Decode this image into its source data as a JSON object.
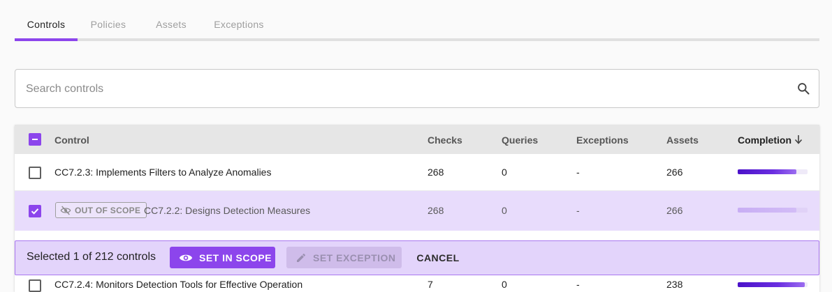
{
  "tabs": [
    {
      "label": "Controls",
      "active": true
    },
    {
      "label": "Policies",
      "active": false
    },
    {
      "label": "Assets",
      "active": false
    },
    {
      "label": "Exceptions",
      "active": false
    }
  ],
  "search": {
    "placeholder": "Search controls",
    "value": "",
    "icon": "search-icon"
  },
  "table": {
    "headers": {
      "control": "Control",
      "checks": "Checks",
      "queries": "Queries",
      "exceptions": "Exceptions",
      "assets": "Assets",
      "completion": "Completion"
    },
    "sort": {
      "column": "completion",
      "direction": "descending",
      "icon": "arrow-down-icon"
    },
    "select_all_state": "indeterminate",
    "rows": [
      {
        "checked": false,
        "out_of_scope": false,
        "control": "CC7.2.3: Implements Filters to Analyze Anomalies",
        "checks": "268",
        "queries": "0",
        "exceptions": "-",
        "assets": "266",
        "completion": 0.84
      },
      {
        "checked": true,
        "out_of_scope": true,
        "badge": "OUT OF SCOPE",
        "control": "CC7.2.2: Designs Detection Measures",
        "checks": "268",
        "queries": "0",
        "exceptions": "-",
        "assets": "266",
        "completion": 0.84
      },
      {
        "checked": false,
        "out_of_scope": false,
        "control": "CC7.2.4: Monitors Detection Tools for Effective Operation",
        "checks": "7",
        "queries": "0",
        "exceptions": "-",
        "assets": "238",
        "completion": 0.96
      }
    ]
  },
  "action_bar": {
    "selection_text": "Selected 1 of 212 controls",
    "set_in_scope": "SET IN SCOPE",
    "set_exception": "SET EXCEPTION",
    "cancel": "CANCEL"
  },
  "colors": {
    "accent": "#8c45ec",
    "selected_row": "#e8dcfc",
    "action_bar": "#e3d4fb"
  }
}
